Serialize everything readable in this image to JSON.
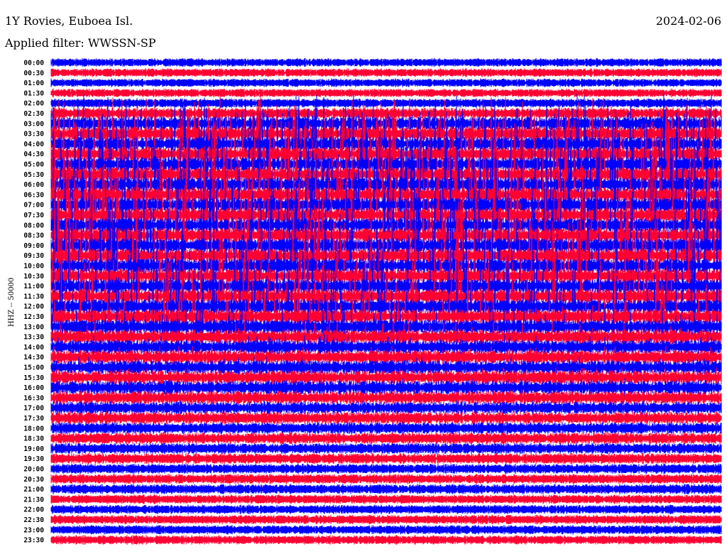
{
  "header": {
    "title": "1Y Rovies, Euboea Isl.",
    "filter": "Applied filter: WWSSN-SP",
    "date": "2024-02-06"
  },
  "chart_data": {
    "type": "line",
    "title": "1Y Rovies, Euboea Isl.",
    "subtitle": "Applied filter: WWSSN-SP",
    "ylabel": "HHZ -- 50000",
    "colors": [
      "#0000ff",
      "#ff0033"
    ],
    "row_labels": [
      "00:00",
      "00:30",
      "01:00",
      "01:30",
      "02:00",
      "02:30",
      "03:00",
      "03:30",
      "04:00",
      "04:30",
      "05:00",
      "05:30",
      "06:00",
      "06:30",
      "07:00",
      "07:30",
      "08:00",
      "08:30",
      "09:00",
      "09:30",
      "10:00",
      "10:30",
      "11:00",
      "11:30",
      "12:00",
      "12:30",
      "13:00",
      "13:30",
      "14:00",
      "14:30",
      "15:00",
      "15:30",
      "16:00",
      "16:30",
      "17:00",
      "17:30",
      "18:00",
      "18:30",
      "19:00",
      "19:30",
      "20:00",
      "20:30",
      "21:00",
      "21:30",
      "22:00",
      "22:30",
      "23:00",
      "23:30"
    ],
    "relative_amplitude": [
      3,
      3,
      3,
      3,
      4,
      6,
      20,
      40,
      55,
      60,
      60,
      60,
      60,
      60,
      60,
      60,
      60,
      60,
      60,
      60,
      60,
      60,
      60,
      55,
      50,
      40,
      25,
      18,
      14,
      12,
      12,
      11,
      10,
      9,
      8,
      8,
      7,
      7,
      6,
      6,
      5,
      5,
      5,
      4,
      4,
      4,
      4,
      4
    ]
  }
}
